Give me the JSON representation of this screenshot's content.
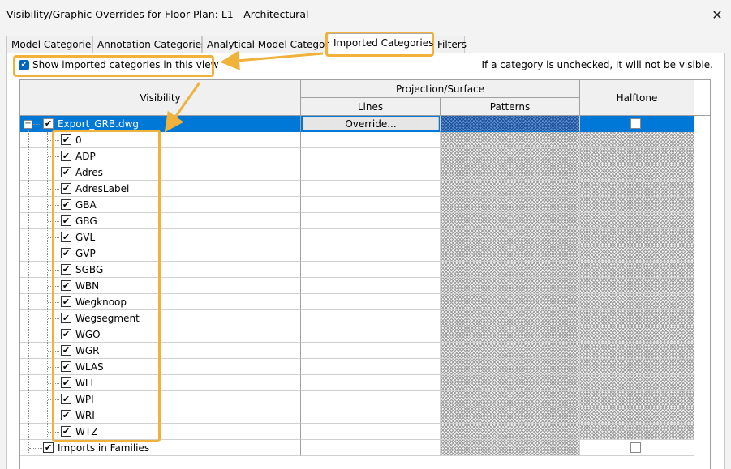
{
  "window": {
    "title": "Visibility/Graphic Overrides for Floor Plan: L1 - Architectural",
    "close_glyph": "✕"
  },
  "tabs": [
    {
      "label": "Model Categories"
    },
    {
      "label": "Annotation Categories"
    },
    {
      "label": "Analytical Model Categories"
    },
    {
      "label": "Imported Categories"
    },
    {
      "label": "Filters"
    }
  ],
  "active_tab": "Imported Categories",
  "show_imported": {
    "label": "Show imported categories in this view",
    "checked": true
  },
  "hint": "If a category is unchecked, it will not be visible.",
  "table": {
    "headers": {
      "visibility": "Visibility",
      "projection": "Projection/Surface",
      "lines": "Lines",
      "patterns": "Patterns",
      "halftone": "Halftone"
    },
    "parent": {
      "name": "Export_GRB.dwg",
      "checked": true,
      "expanded": true,
      "expander_glyph": "−",
      "override_label": "Override...",
      "halftone": false
    },
    "layers": [
      "0",
      "ADP",
      "Adres",
      "AdresLabel",
      "GBA",
      "GBG",
      "GVL",
      "GVP",
      "SGBG",
      "WBN",
      "Wegknoop",
      "Wegsegment",
      "WGO",
      "WGR",
      "WLAS",
      "WLI",
      "WPI",
      "WRI",
      "WTZ"
    ],
    "imports_in_families": {
      "name": "Imports in Families",
      "checked": true,
      "halftone": false
    }
  },
  "colors": {
    "selection": "#0078d7",
    "annotation": "#f0b23a",
    "checkbox_accent": "#0067c0"
  },
  "icons": {
    "checkmark": "✔",
    "close": "close-icon",
    "expander": "collapse-minus-icon"
  }
}
